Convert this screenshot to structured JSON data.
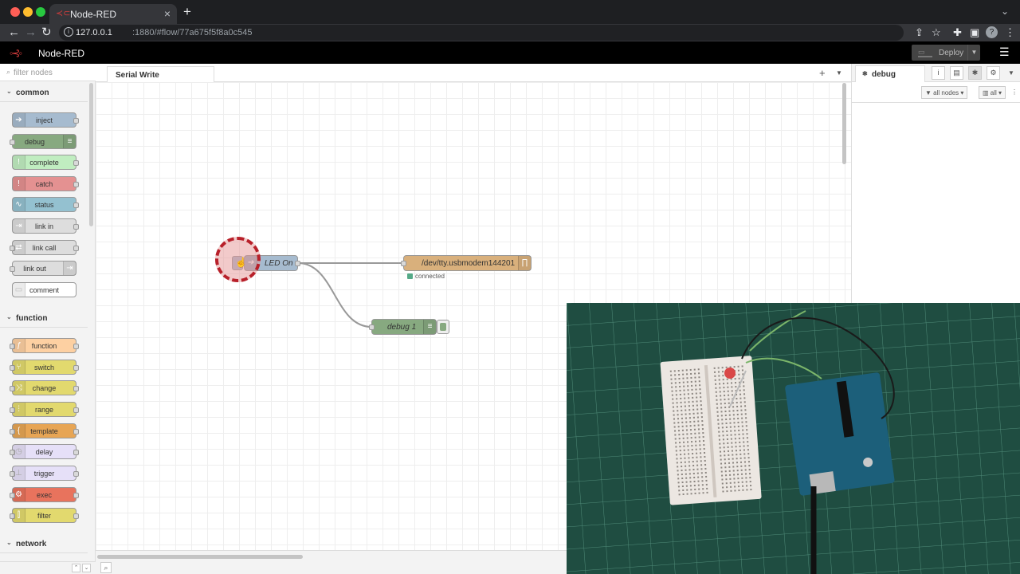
{
  "browser": {
    "tab_title": "Node-RED",
    "url_host": "127.0.0.1",
    "url_path": ":1880/#flow/77a675f5f8a0c545"
  },
  "header": {
    "app_title": "Node-RED",
    "deploy_label": "Deploy"
  },
  "palette": {
    "filter_placeholder": "filter nodes",
    "categories": [
      {
        "label": "common"
      },
      {
        "label": "function"
      },
      {
        "label": "network"
      }
    ],
    "common_nodes": [
      {
        "label": "inject",
        "color": "#a6bbcf"
      },
      {
        "label": "debug",
        "color": "#87a980"
      },
      {
        "label": "complete",
        "color": "#c0edc0"
      },
      {
        "label": "catch",
        "color": "#e49191"
      },
      {
        "label": "status",
        "color": "#94c1d0"
      },
      {
        "label": "link in",
        "color": "#dddddd"
      },
      {
        "label": "link call",
        "color": "#dddddd"
      },
      {
        "label": "link out",
        "color": "#dddddd"
      },
      {
        "label": "comment",
        "color": "#ffffff"
      }
    ],
    "function_nodes": [
      {
        "label": "function",
        "color": "#fdd0a2"
      },
      {
        "label": "switch",
        "color": "#e2d96e"
      },
      {
        "label": "change",
        "color": "#e2d96e"
      },
      {
        "label": "range",
        "color": "#e2d96e"
      },
      {
        "label": "template",
        "color": "#e7a554"
      },
      {
        "label": "delay",
        "color": "#e6e0f8"
      },
      {
        "label": "trigger",
        "color": "#e6e0f8"
      },
      {
        "label": "exec",
        "color": "#e8735d"
      },
      {
        "label": "filter",
        "color": "#e2d96e"
      }
    ]
  },
  "workspace": {
    "tab_label": "Serial Write",
    "nodes": {
      "inject_label": "LED On",
      "serial_label": "/dev/tty.usbmodem144201",
      "serial_status": "connected",
      "debug_label": "debug 1"
    }
  },
  "sidebar": {
    "tab_label": "debug",
    "filter_nodes_label": "all nodes",
    "filter_level_label": "all"
  }
}
